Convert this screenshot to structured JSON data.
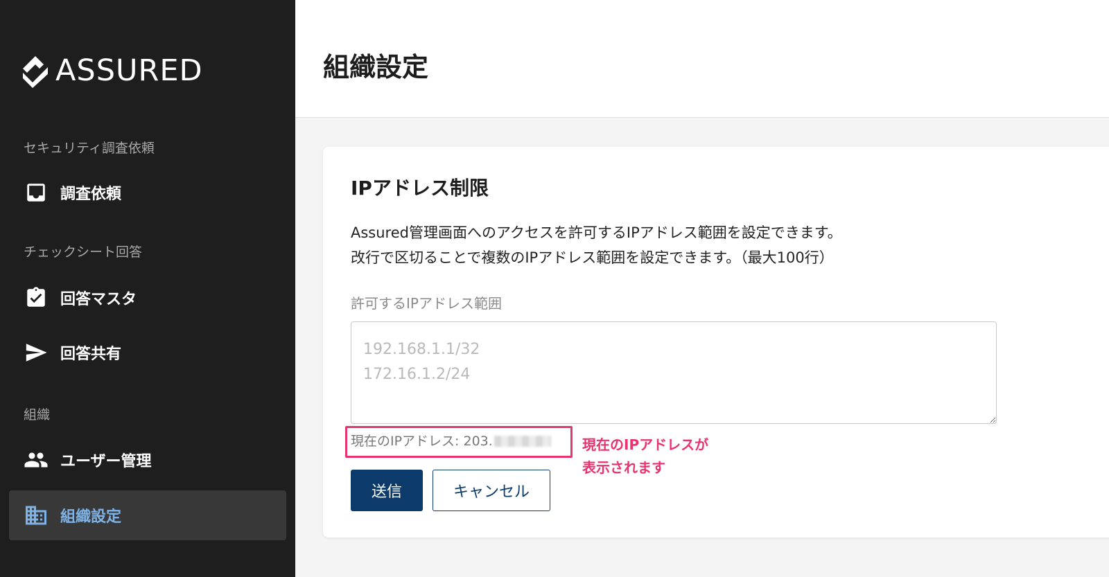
{
  "brand": {
    "name": "ASSURED"
  },
  "sidebar": {
    "sections": [
      {
        "title": "セキュリティ調査依頼"
      },
      {
        "title": "チェックシート回答"
      },
      {
        "title": "組織"
      }
    ],
    "items": [
      {
        "label": "調査依頼",
        "icon": "inbox-icon"
      },
      {
        "label": "回答マスタ",
        "icon": "clipboard-check-icon"
      },
      {
        "label": "回答共有",
        "icon": "send-icon"
      },
      {
        "label": "ユーザー管理",
        "icon": "people-icon"
      },
      {
        "label": "組織設定",
        "icon": "building-icon",
        "active": true
      }
    ]
  },
  "header": {
    "title": "組織設定"
  },
  "card": {
    "title": "IPアドレス制限",
    "description_lines": [
      "Assured管理画面へのアクセスを許可するIPアドレス範囲を設定できます。",
      "改行で区切ることで複数のIPアドレス範囲を設定できます。（最大100行）"
    ],
    "field_label": "許可するIPアドレス範囲",
    "textarea_placeholder": "192.168.1.1/32\n172.16.1.2/24",
    "current_ip_label": "現在のIPアドレス: 203.",
    "annotation_lines": [
      "現在のIPアドレスが",
      "表示されます"
    ],
    "submit_label": "送信",
    "cancel_label": "キャンセル"
  },
  "colors": {
    "sidebar_bg": "#1e1e1e",
    "active_item_bg": "#383838",
    "active_item_text": "#7fb3e8",
    "primary": "#0b3a6b",
    "annotation": "#e8336e"
  }
}
